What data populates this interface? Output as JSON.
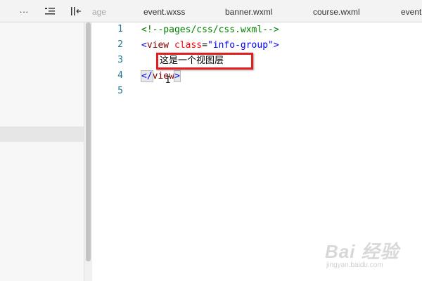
{
  "toolbar": {
    "more_label": "···",
    "indent_icon": "≡",
    "collapse_icon": "⟲"
  },
  "tabs": [
    {
      "label": "age",
      "faded": true
    },
    {
      "label": "event.wxss"
    },
    {
      "label": "banner.wxml"
    },
    {
      "label": "course.wxml"
    },
    {
      "label": "event"
    }
  ],
  "editor": {
    "line_numbers": [
      "1",
      "2",
      "3",
      "4",
      "5"
    ],
    "line1": "<!--pages/css/css.wxml-->",
    "line2": {
      "open": "<",
      "tag": "view",
      "attr": "class",
      "eq": "=",
      "value": "\"info-group\"",
      "close": ">"
    },
    "line3_text": "这是一个视图层",
    "line4": {
      "open": "</",
      "tag": "view",
      "close": ">"
    },
    "cursor_glyph": "I"
  },
  "watermark": {
    "main": "Bai 经验",
    "sub": "jingyan.baidu.com"
  }
}
